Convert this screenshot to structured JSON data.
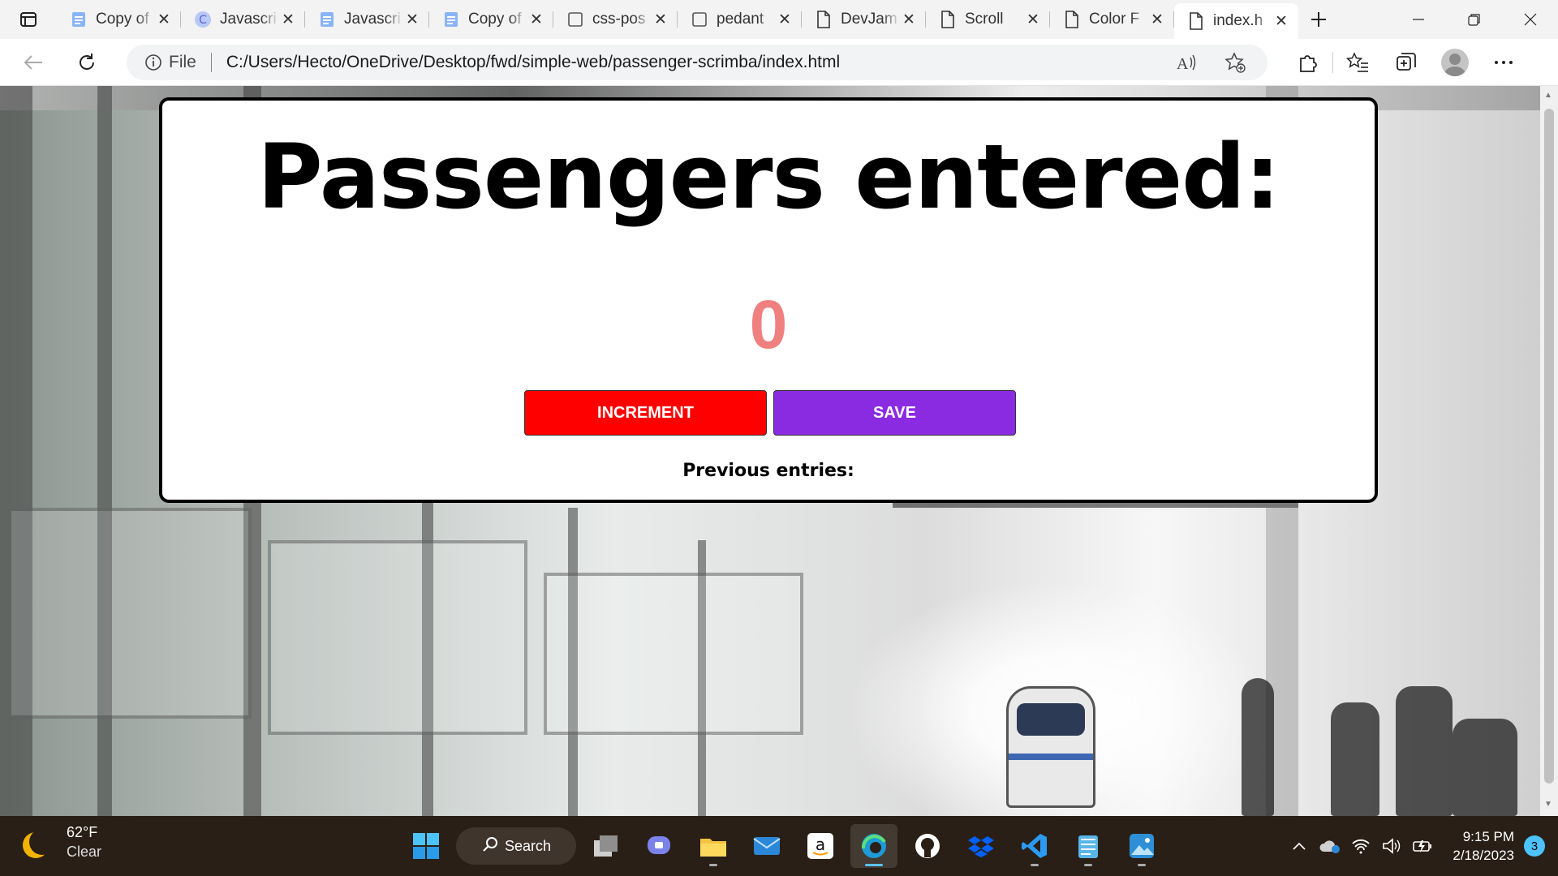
{
  "browser": {
    "tabs": [
      {
        "title": "Copy of",
        "icon": "docs-icon",
        "active": false
      },
      {
        "title": "Javascri",
        "icon": "c-logo-icon",
        "active": false
      },
      {
        "title": "Javascri",
        "icon": "docs-icon",
        "active": false
      },
      {
        "title": "Copy of",
        "icon": "docs-icon",
        "active": false
      },
      {
        "title": "css-pos",
        "icon": "blank-tab-icon",
        "active": false
      },
      {
        "title": "pedant",
        "icon": "blank-tab-icon",
        "active": false
      },
      {
        "title": "DevJam",
        "icon": "page-icon",
        "active": false
      },
      {
        "title": "Scroll",
        "icon": "page-icon",
        "active": false
      },
      {
        "title": "Color F",
        "icon": "page-icon",
        "active": false
      },
      {
        "title": "index.h",
        "icon": "page-icon",
        "active": true
      }
    ],
    "address": {
      "scheme_label": "File",
      "url": "C:/Users/Hecto/OneDrive/Desktop/fwd/simple-web/passenger-scrimba/index.html"
    }
  },
  "app": {
    "heading": "Passengers entered:",
    "count": "0",
    "increment_label": "INCREMENT",
    "save_label": "SAVE",
    "previous_label": "Previous entries:",
    "colors": {
      "count": "#f08080",
      "increment": "#ff0000",
      "save": "#8a2be2"
    }
  },
  "taskbar": {
    "weather": {
      "temp": "62°F",
      "condition": "Clear"
    },
    "search_label": "Search",
    "clock": {
      "time": "9:15 PM",
      "date": "2/18/2023"
    },
    "notifications": "3"
  }
}
